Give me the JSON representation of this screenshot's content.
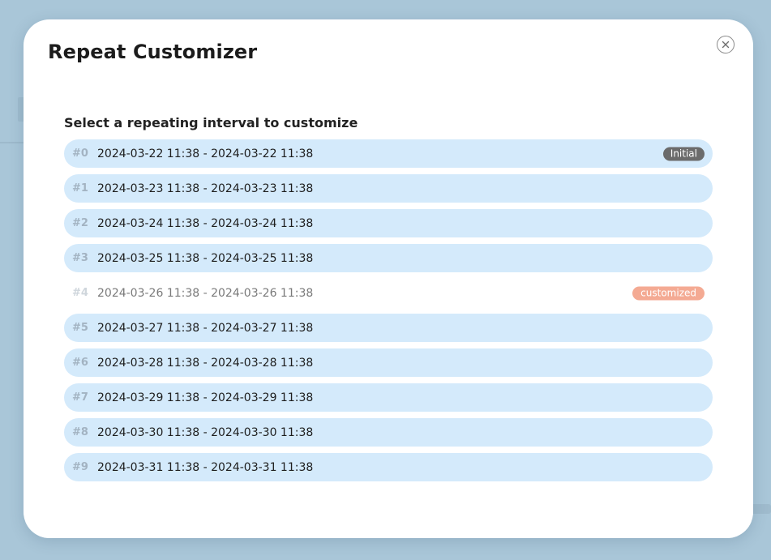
{
  "modal": {
    "title": "Repeat Customizer",
    "section_label": "Select a repeating interval to customize"
  },
  "icons": {
    "close": "close-icon"
  },
  "colors": {
    "backdrop": "#a9c6d8",
    "row_background": "#d4eafb",
    "initial_badge": "#6b6b6b",
    "customized_badge": "#f4aa93"
  },
  "intervals": [
    {
      "index": "#0",
      "range": "2024-03-22 11:38 - 2024-03-22 11:38",
      "badge": "Initial"
    },
    {
      "index": "#1",
      "range": "2024-03-23 11:38 - 2024-03-23 11:38",
      "badge": ""
    },
    {
      "index": "#2",
      "range": "2024-03-24 11:38 - 2024-03-24 11:38",
      "badge": ""
    },
    {
      "index": "#3",
      "range": "2024-03-25 11:38 - 2024-03-25 11:38",
      "badge": ""
    },
    {
      "index": "#4",
      "range": "2024-03-26 11:38 - 2024-03-26 11:38",
      "badge": "customized"
    },
    {
      "index": "#5",
      "range": "2024-03-27 11:38 - 2024-03-27 11:38",
      "badge": ""
    },
    {
      "index": "#6",
      "range": "2024-03-28 11:38 - 2024-03-28 11:38",
      "badge": ""
    },
    {
      "index": "#7",
      "range": "2024-03-29 11:38 - 2024-03-29 11:38",
      "badge": ""
    },
    {
      "index": "#8",
      "range": "2024-03-30 11:38 - 2024-03-30 11:38",
      "badge": ""
    },
    {
      "index": "#9",
      "range": "2024-03-31 11:38 - 2024-03-31 11:38",
      "badge": ""
    }
  ]
}
